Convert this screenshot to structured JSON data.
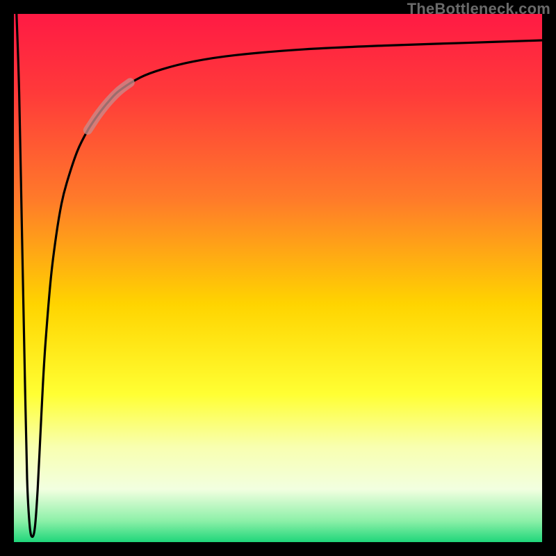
{
  "attribution": "TheBottleneck.com",
  "colors": {
    "frame_bg": "#000000",
    "curve_stroke": "#000000",
    "highlight_stroke": "#c98a8a",
    "gradient_stops": [
      {
        "offset": 0.0,
        "color": "#ff1a44"
      },
      {
        "offset": 0.15,
        "color": "#ff3a3a"
      },
      {
        "offset": 0.35,
        "color": "#ff7a2a"
      },
      {
        "offset": 0.55,
        "color": "#ffd400"
      },
      {
        "offset": 0.72,
        "color": "#ffff33"
      },
      {
        "offset": 0.82,
        "color": "#f8ffb0"
      },
      {
        "offset": 0.9,
        "color": "#f2ffe0"
      },
      {
        "offset": 0.96,
        "color": "#8cf0a8"
      },
      {
        "offset": 1.0,
        "color": "#1fd67a"
      }
    ]
  },
  "chart_data": {
    "type": "line",
    "title": "",
    "xlabel": "",
    "ylabel": "",
    "xlim": [
      0,
      100
    ],
    "ylim": [
      0,
      100
    ],
    "series": [
      {
        "name": "bottleneck-curve",
        "x": [
          0.5,
          1.0,
          1.5,
          2.0,
          2.5,
          3.0,
          3.5,
          4.0,
          4.5,
          5.0,
          5.5,
          6.0,
          7.0,
          8.0,
          9.0,
          10.0,
          12.0,
          14.0,
          16.0,
          18.0,
          20.0,
          24.0,
          28.0,
          34.0,
          42.0,
          55.0,
          70.0,
          85.0,
          100.0
        ],
        "y": [
          100,
          85,
          60,
          35,
          12,
          3,
          1,
          3,
          10,
          20,
          30,
          38,
          50,
          58,
          64,
          68,
          74,
          78,
          81,
          83.5,
          85.5,
          88,
          89.5,
          91,
          92.2,
          93.3,
          94,
          94.5,
          95
        ]
      },
      {
        "name": "highlight-segment",
        "x": [
          14.0,
          16.0,
          18.0,
          20.0,
          22.0
        ],
        "y": [
          78,
          81,
          83.5,
          85.5,
          87
        ]
      }
    ]
  }
}
